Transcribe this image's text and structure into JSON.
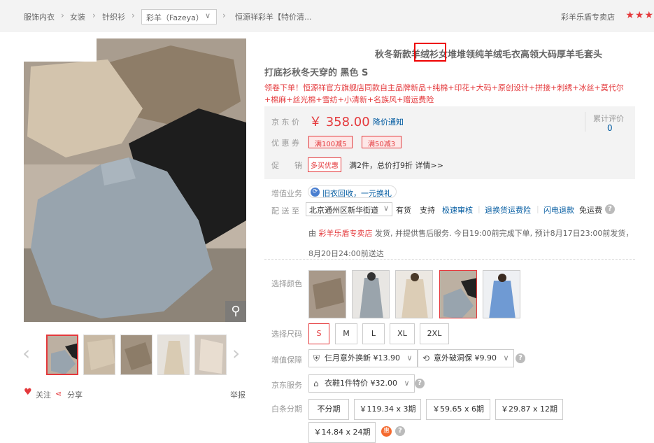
{
  "breadcrumb": {
    "items": [
      "服饰内衣",
      "女装",
      "针织衫"
    ],
    "brand": "彩羊（Fazeya）",
    "product_short": "恒源祥彩羊【特价清..."
  },
  "shop": {
    "name": "彩羊乐盾专卖店",
    "rating_stars": "★★★"
  },
  "product": {
    "title_line1": "秋冬新款羊绒衫女堆堆领纯羊绒毛衣高领大码厚羊毛套头",
    "title_line2": "打底衫秋冬天穿的 黑色 S",
    "promo_text": "领卷下单！恒源祥官方旗舰店同款自主品牌新品+纯棉+印花+大码+原创设计+拼接+刺绣+冰丝+莫代尔+棉麻+丝光棉+雪纺+小清新+名族风+赠运费险"
  },
  "price_box": {
    "price_label": "京 东 价",
    "price": "￥ 358.00",
    "price_notice": "降价通知",
    "review_label": "累计评价",
    "review_count": "0",
    "coupon_label": "优 惠 券",
    "coupons": [
      "满100减5",
      "满50减3"
    ],
    "promo_label": "促　　销",
    "promo_tag": "多买优惠",
    "promo_text": "满2件，总价打9折",
    "promo_detail": "详情>>"
  },
  "value_added": {
    "label": "增值业务",
    "pill": "旧衣回收，一元换礼",
    "pill_icon": "recycle-icon"
  },
  "delivery": {
    "label": "配 送 至",
    "address": "北京通州区新华街道",
    "stock": "有货",
    "support": "支持",
    "services": [
      "极速审核",
      "退换货运费险",
      "闪电退款"
    ],
    "free_shipping": "免运费",
    "ship_prefix": "由",
    "ship_shop": "彩羊乐盾专卖店",
    "ship_text": "发货, 并提供售后服务. 今日19:00前完成下单, 预计8月17日23:00前发货，8月20日24:00前送达"
  },
  "color": {
    "label": "选择颜色",
    "selected_index": 3
  },
  "size": {
    "label": "选择尺码",
    "options": [
      "S",
      "M",
      "L",
      "XL",
      "2XL"
    ],
    "selected": "S"
  },
  "guarantee": {
    "label": "增值保障",
    "options": [
      "仨月意外换新 ¥13.90",
      "意外破洞保 ¥9.90"
    ]
  },
  "jd_service": {
    "label": "京东服务",
    "option": "衣鞋1件特价 ¥32.00"
  },
  "installment": {
    "label": "白条分期",
    "options": [
      "不分期",
      "￥119.34 x 3期",
      "￥59.65 x 6期",
      "￥29.87 x 12期",
      "￥14.84 x 24期"
    ],
    "badge": "惠"
  },
  "social": {
    "follow": "关注",
    "share": "分享",
    "report": "举报"
  },
  "colors": {
    "accent": "#e4393c",
    "link": "#005aa0"
  }
}
